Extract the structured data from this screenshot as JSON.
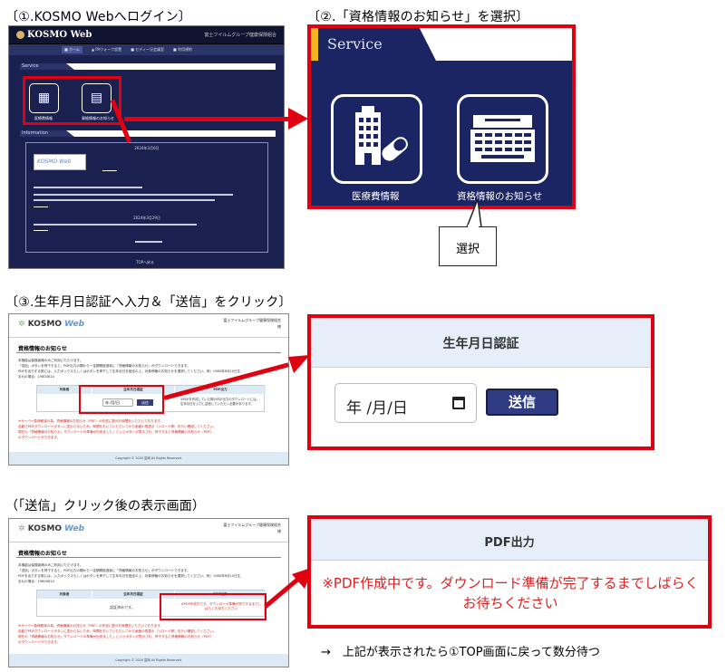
{
  "headings": {
    "step1": "〔①.KOSMO Webへログイン〕",
    "step2": "〔②.「資格情報のお知らせ」を選択〕",
    "step3": "〔③.生年月日認証へ入力＆「送信」をクリック〕",
    "step4": "（「送信」クリック後の表示画面）"
  },
  "kosmo_top": {
    "logo": "KOSMO Web",
    "org": "富士フイルムグループ健康保険組合",
    "nav": [
      "■ ホーム",
      "▲ PAウォーク設置",
      "■ セディー兄会議室",
      "■ 利用規約"
    ],
    "service_label": "Service",
    "info_label": "Information",
    "icon1_label": "医療費情報",
    "icon2_label": "資格情報のお知らせ",
    "info_date1": "2024年3月6日",
    "info_date2": "2024年3月29日",
    "info_card": "KOSMO Web",
    "bottom_link": "TOPへ戻る"
  },
  "zoom_service": {
    "label": "Service",
    "icon1_label": "医療費情報",
    "icon2_label": "資格情報のお知らせ"
  },
  "callout": {
    "text": "選択"
  },
  "form_shot": {
    "logo_prefix": "KOSMO",
    "logo_suffix": "Web",
    "org_line1": "富士フイルムグループ健康保険組合",
    "org_line2": "様",
    "page_title": "資格情報のお知らせ",
    "para1": "本機能は保険者様のみご利用いただけます。",
    "para2": "「送信」ボタンを押下すると、PDF出力の欄から一定期間経過後に「資格情報のお知らせ」がダウンロードできます。",
    "para3": "PDFを出力する際には、入力ボックスもしくはボタンを押下して生年月日を指定の上、対象債権のお知らせを選択してください。例）1980年8月10日生",
    "para4": "まれの場合：19800810",
    "col_target": "対象者",
    "col_auth": "生年月日認証",
    "col_pdf": "PDF出力",
    "date_text": "年 /月/日",
    "send_label": "送信",
    "pdf_note": "※PDFを作成していた際のPDF出力のダウンロードには、生年月日を入力し送信していただく必要があります。",
    "warn1": "※サーバー負荷軽減の為、資格情報のお知らせ（PDF）の作成に数分お時間をいただいております。",
    "warn2": "自動でPDFダウンロードボタンに変わらないため、時間をおいていただいてから画面の再表示（リロード等）を行い確認してください。",
    "warn3": "現在の「資格情報のお知らせ」ダウンロードの準備が出来ました」というボタンが表示され、押下すると資格情報のお知らせ（PDF）",
    "warn4": "のダウンロードができます。",
    "footer": "Copyright © 2020 富岡 All Rights Reserved.",
    "authed_text": "認証済みです。",
    "pdf_creating": "※PDF作成中です。ダウンロード準備が完了するまでしばらくお待ちください"
  },
  "zoom_auth": {
    "title": "生年月日認証",
    "date_text": "年 /月/日",
    "send_label": "送信"
  },
  "zoom_pdf": {
    "title": "PDF出力",
    "message": "※PDF作成中です。ダウンロード準備が完了するまでしばらくお待ちください"
  },
  "note": "→　上記が表示されたら①TOP画面に戻って数分待つ"
}
